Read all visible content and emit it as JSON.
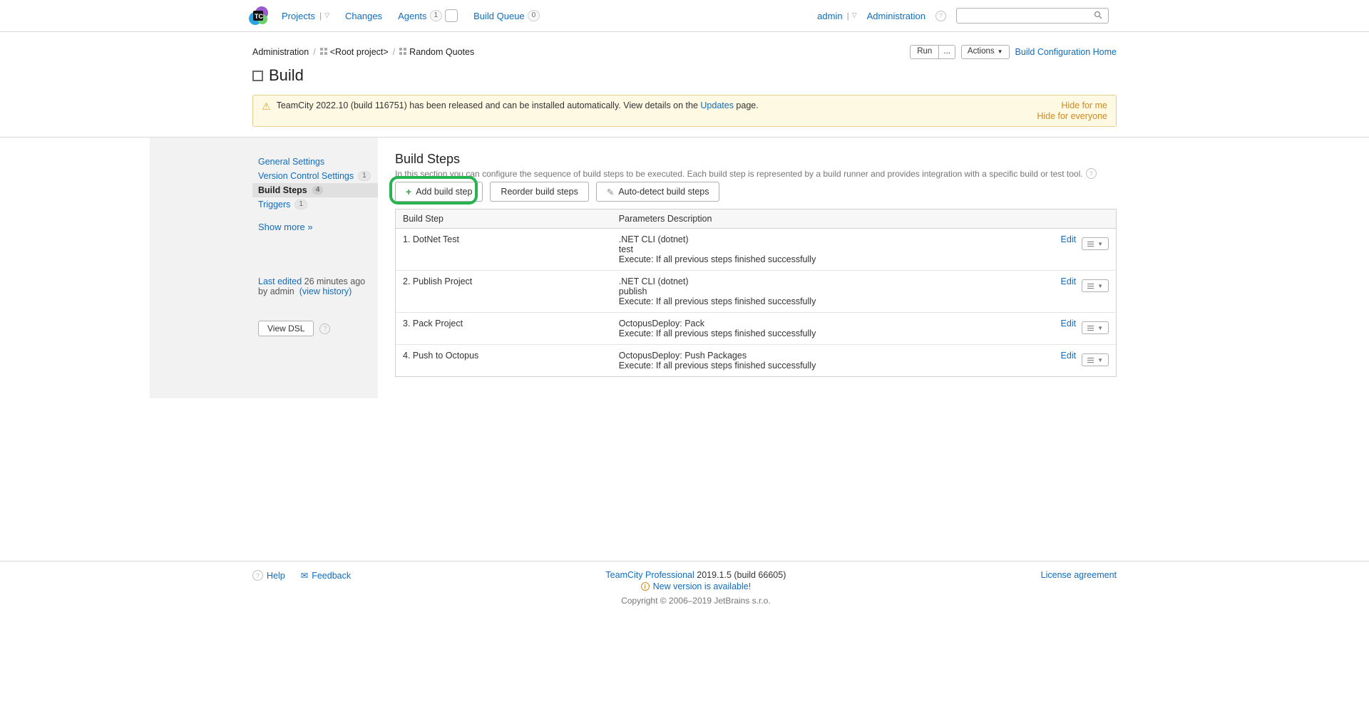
{
  "topbar": {
    "nav": {
      "projects": "Projects",
      "changes": "Changes",
      "agents": "Agents",
      "agents_count": "1",
      "build_queue": "Build Queue",
      "build_queue_count": "0"
    },
    "right": {
      "user": "admin",
      "administration": "Administration"
    }
  },
  "breadcrumbs": {
    "administration": "Administration",
    "root": "<Root project>",
    "project": "Random Quotes"
  },
  "header_actions": {
    "run": "Run",
    "more": "...",
    "actions": "Actions",
    "home_link": "Build Configuration Home"
  },
  "page_title": "Build",
  "banner": {
    "text_before": "TeamCity 2022.10 (build 116751) has been released and can be installed automatically. View details on the ",
    "link": "Updates",
    "text_after": " page.",
    "hide_me": "Hide for me",
    "hide_all": "Hide for everyone"
  },
  "sidebar": {
    "items": [
      {
        "label": "General Settings",
        "badge": ""
      },
      {
        "label": "Version Control Settings",
        "badge": "1"
      },
      {
        "label": "Build Steps",
        "badge": "4"
      },
      {
        "label": "Triggers",
        "badge": "1"
      }
    ],
    "show_more": "Show more »",
    "last_edited_prefix": "Last edited",
    "last_edited_when": " 26 minutes ago",
    "by_prefix": "by ",
    "by_user": "admin",
    "view_history": "(view history)",
    "view_dsl": "View DSL"
  },
  "main": {
    "title": "Build Steps",
    "desc": "In this section you can configure the sequence of build steps to be executed. Each build step is represented by a build runner and provides integration with a specific build or test tool.",
    "add_btn": "Add build step",
    "reorder_btn": "Reorder build steps",
    "autodetect_btn": "Auto-detect build steps",
    "col_build_step": "Build Step",
    "col_params": "Parameters Description",
    "edit_label": "Edit",
    "steps": [
      {
        "n": "1.",
        "name": "DotNet Test",
        "p1": ".NET CLI (dotnet)",
        "p2": "test",
        "p3": "Execute: If all previous steps finished successfully"
      },
      {
        "n": "2.",
        "name": "Publish Project",
        "p1": ".NET CLI (dotnet)",
        "p2": "publish",
        "p3": "Execute: If all previous steps finished successfully"
      },
      {
        "n": "3.",
        "name": "Pack Project",
        "p1": "OctopusDeploy: Pack",
        "p2": "",
        "p3": "Execute: If all previous steps finished successfully"
      },
      {
        "n": "4.",
        "name": "Push to Octopus",
        "p1": "OctopusDeploy: Push Packages",
        "p2": "",
        "p3": "Execute: If all previous steps finished successfully"
      }
    ]
  },
  "footer": {
    "help": "Help",
    "feedback": "Feedback",
    "product": "TeamCity Professional",
    "version": " 2019.1.5 (build 66605)",
    "available": "New version is available!",
    "copyright": "Copyright © 2006–2019 JetBrains s.r.o.",
    "license": "License agreement"
  }
}
